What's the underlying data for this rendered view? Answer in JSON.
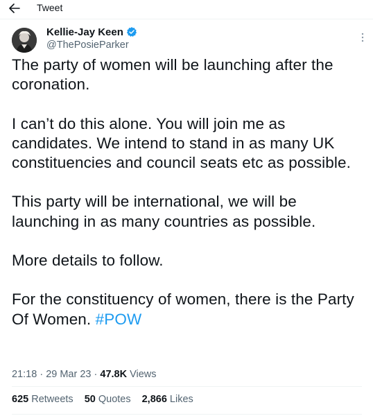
{
  "header": {
    "title": "Tweet",
    "back_icon": "back-arrow-icon"
  },
  "author": {
    "display_name": "Kellie-Jay Keen",
    "handle": "@ThePosieParker",
    "verified": true,
    "verified_color": "#1d9bf0"
  },
  "tweet": {
    "paragraphs": [
      "The party of women will be launching after the coronation.",
      "I can’t do this alone. You will join me as candidates. We intend to stand in as many UK constituencies and council seats etc as possible.",
      "This party will be international, we will be launching in as many countries as possible.",
      "More details to follow."
    ],
    "last_paragraph_text": "For the constituency of women, there is the Party Of Women. ",
    "hashtag": "#POW"
  },
  "meta": {
    "time": "21:18",
    "separator1": " · ",
    "date": "29 Mar 23",
    "separator2": " · ",
    "views_count": "47.8K",
    "views_label": " Views"
  },
  "stats": {
    "retweets_count": "625",
    "retweets_label": " Retweets",
    "quotes_count": "50",
    "quotes_label": " Quotes",
    "likes_count": "2,866",
    "likes_label": " Likes"
  },
  "colors": {
    "text": "#0f1419",
    "secondary": "#536471",
    "accent": "#1d9bf0",
    "divider": "#eff3f4"
  }
}
